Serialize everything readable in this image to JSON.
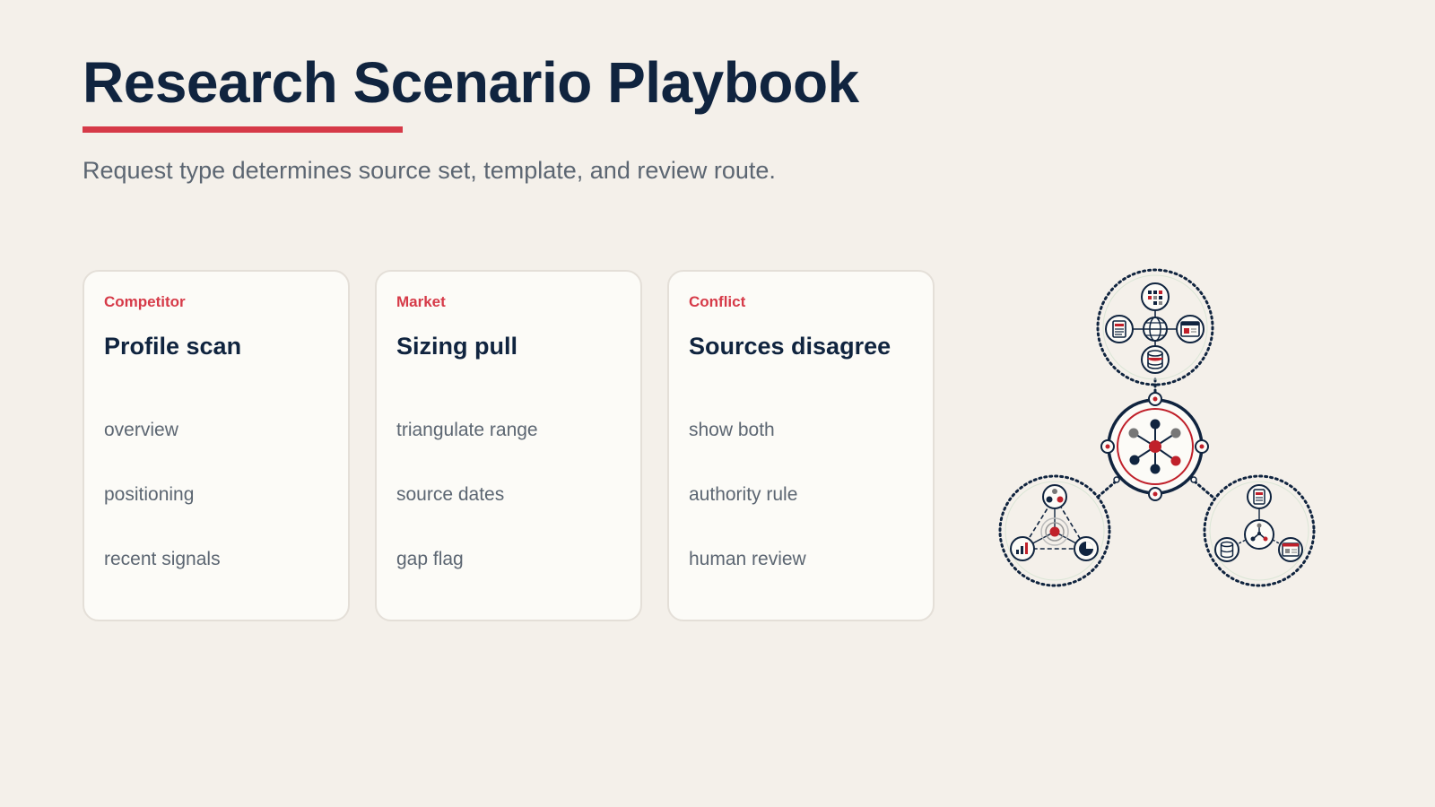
{
  "header": {
    "title": "Research Scenario Playbook",
    "subtitle": "Request type determines source set, template, and review route."
  },
  "cards": [
    {
      "tag": "Competitor",
      "title": "Profile scan",
      "items": [
        "overview",
        "positioning",
        "recent signals"
      ]
    },
    {
      "tag": "Market",
      "title": "Sizing pull",
      "items": [
        "triangulate range",
        "source dates",
        "gap flag"
      ]
    },
    {
      "tag": "Conflict",
      "title": "Sources disagree",
      "items": [
        "show both",
        "authority rule",
        "human review"
      ]
    }
  ],
  "illustration": {
    "icons": [
      "network-hub-icon",
      "globe-icon",
      "grid-icon",
      "document-icon",
      "browser-window-icon",
      "database-icon",
      "target-icon",
      "bar-chart-icon",
      "pie-chart-icon",
      "people-icon",
      "branch-icon"
    ]
  },
  "colors": {
    "background": "#f4f0ea",
    "navy": "#10243f",
    "accent_red": "#d63a48",
    "muted_text": "#5c6672",
    "card_bg": "#fcfbf7",
    "card_border": "#e4dfd8"
  }
}
